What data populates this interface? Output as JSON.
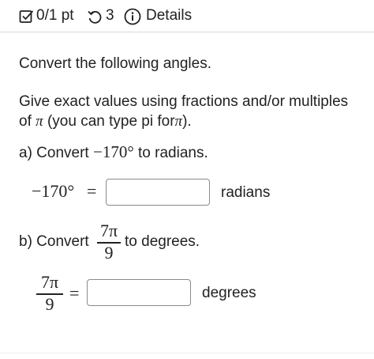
{
  "header": {
    "score": "0/1 pt",
    "retries": "3",
    "details_label": "Details"
  },
  "question": {
    "intro": "Convert the following angles.",
    "instructions_line1": "Give exact values using fractions and/or multiples",
    "instructions_line2_pre": "of",
    "instructions_line2_pi": "π",
    "instructions_line2_mid": "(you can type pi for",
    "instructions_line2_pi2": "π",
    "instructions_line2_post": ").",
    "part_a": {
      "label": "a) Convert",
      "angle": "−170°",
      "suffix": "to radians.",
      "lhs": "−170°",
      "equals": "=",
      "input_value": "",
      "unit": "radians"
    },
    "part_b": {
      "label": "b) Convert",
      "numerator": "7π",
      "denominator": "9",
      "suffix": "to degrees.",
      "lhs_numerator": "7π",
      "lhs_denominator": "9",
      "equals": "=",
      "input_value": "",
      "unit": "degrees"
    }
  },
  "colors": {
    "text": "#222222",
    "divider": "#d9d9d9",
    "input_border": "#8a8a8a"
  }
}
